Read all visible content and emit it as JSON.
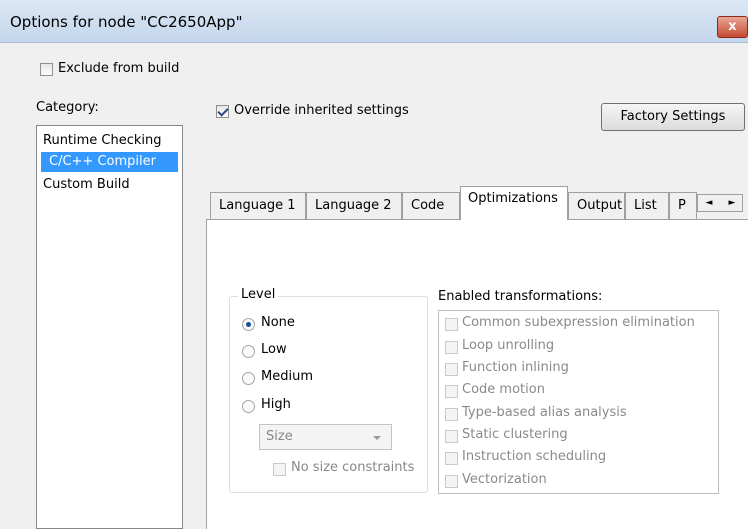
{
  "window": {
    "title": "Options for node \"CC2650App\"",
    "close_label": "x"
  },
  "exclude": {
    "label": "Exclude from build",
    "checked": false
  },
  "category": {
    "label": "Category:",
    "items": [
      {
        "label": "Runtime Checking",
        "selected": false
      },
      {
        "label": "C/C++ Compiler",
        "selected": true
      },
      {
        "label": "Custom Build",
        "selected": false
      }
    ]
  },
  "override": {
    "label": "Override inherited settings",
    "checked": true
  },
  "factory_label": "Factory Settings",
  "tabs": [
    {
      "label": "Language 1",
      "active": false
    },
    {
      "label": "Language 2",
      "active": false
    },
    {
      "label": "Code",
      "active": false
    },
    {
      "label": "Optimizations",
      "active": true
    },
    {
      "label": "Output",
      "active": false
    },
    {
      "label": "List",
      "active": false
    },
    {
      "label": "P",
      "active": false
    }
  ],
  "tab_scroll": {
    "left": "◄",
    "right": "►"
  },
  "level": {
    "label": "Level",
    "options": [
      {
        "label": "None",
        "selected": true
      },
      {
        "label": "Low",
        "selected": false
      },
      {
        "label": "Medium",
        "selected": false
      },
      {
        "label": "High",
        "selected": false
      }
    ],
    "size_value": "Size",
    "no_size_label": "No size constraints"
  },
  "transformations": {
    "label": "Enabled transformations:",
    "items": [
      "Common subexpression elimination",
      "Loop unrolling",
      "Function inlining",
      "Code motion",
      "Type-based alias analysis",
      "Static clustering",
      "Instruction scheduling",
      "Vectorization"
    ]
  }
}
